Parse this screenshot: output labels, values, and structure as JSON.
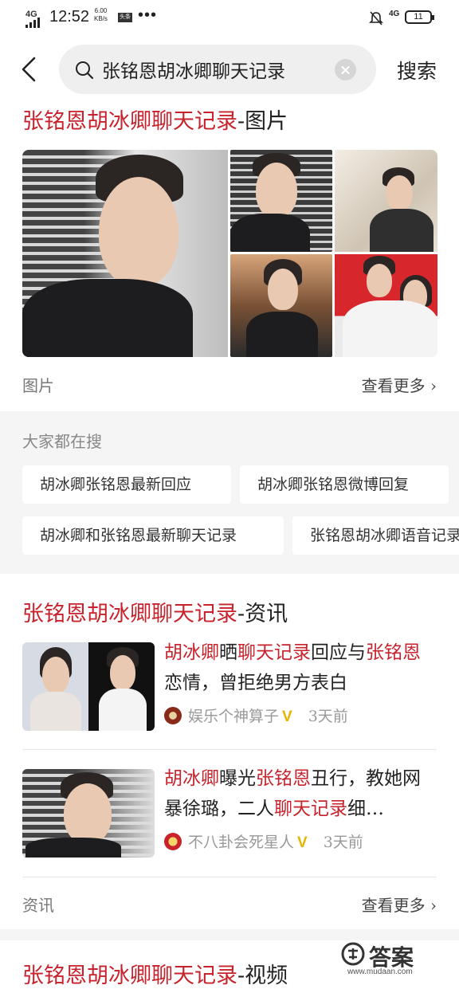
{
  "status_bar": {
    "network": "4G",
    "time": "12:52",
    "speed_value": "6.00",
    "speed_unit": "KB/s",
    "app_badge": "头条",
    "more": "•••",
    "network_right": "4G",
    "battery": "11"
  },
  "search": {
    "query": "张铭恩胡冰卿聊天记录",
    "button": "搜索"
  },
  "images_section": {
    "title_keyword": "张铭恩胡冰卿聊天记录",
    "title_suffix": "-图片",
    "footer_label": "图片",
    "more_label": "查看更多"
  },
  "hot_searches": {
    "title": "大家都在搜",
    "chips": [
      "胡冰卿张铭恩最新回应",
      "胡冰卿张铭恩微博回复",
      "胡冰卿和张铭恩最新聊天记录",
      "张铭恩胡冰卿语音记录"
    ]
  },
  "news_section": {
    "title_keyword": "张铭恩胡冰卿聊天记录",
    "title_suffix": "-资讯",
    "items": [
      {
        "t1": "胡冰卿",
        "t2": "晒",
        "t3": "聊天记录",
        "t4": "回应与",
        "t5": "张铭恩",
        "t6": "恋情，曾拒绝男方表白",
        "source": "娱乐个神算子",
        "verified": "V",
        "time": "3天前"
      },
      {
        "t1": "胡冰卿",
        "t2": "曝光",
        "t3": "张铭恩",
        "t4": "丑行，教她网暴徐璐，二人",
        "t5": "聊天记录",
        "t6": "细…",
        "source": "不八卦会死星人",
        "verified": "V",
        "time": "3天前"
      }
    ],
    "footer_label": "资讯",
    "more_label": "查看更多"
  },
  "video_section": {
    "title_keyword": "张铭恩胡冰卿聊天记录",
    "title_suffix": "-视频"
  },
  "watermark": {
    "text": "答案",
    "url": "www.mudaan.com"
  },
  "colors": {
    "highlight": "#c8232c",
    "verified": "#e7b400",
    "panel_bg": "#f5f5f5"
  }
}
